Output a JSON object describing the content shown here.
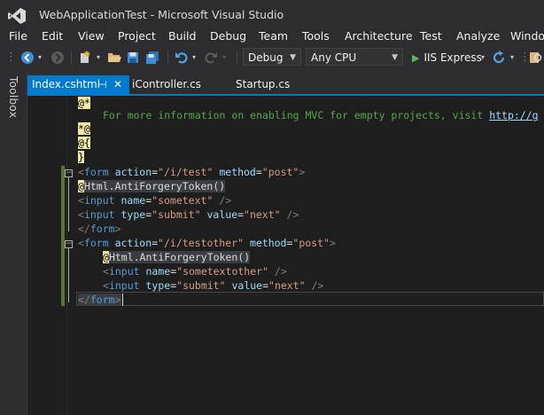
{
  "window": {
    "title": "WebApplicationTest - Microsoft Visual Studio"
  },
  "menu": {
    "items": [
      "File",
      "Edit",
      "View",
      "Project",
      "Build",
      "Debug",
      "Team",
      "Tools",
      "Architecture",
      "Test",
      "Analyze",
      "Window"
    ]
  },
  "toolbar": {
    "config_value": "Debug",
    "platform_value": "Any CPU",
    "run_label": "IIS Express"
  },
  "toolbox": {
    "label": "Toolbox"
  },
  "tabs": [
    {
      "label": "Index.cshtml",
      "active": true
    },
    {
      "label": "iController.cs",
      "active": false
    },
    {
      "label": "Startup.cs",
      "active": false
    }
  ],
  "code": {
    "l1_razor": "@*",
    "l2_comment": "For more information on enabling MVC for empty projects, visit ",
    "l2_link": "http://g",
    "l3_razor": "*@",
    "l4_razor": "@{",
    "l5_razor": "}",
    "form1_open": {
      "lt": "<",
      "name": "form",
      "a1": "action",
      "eq1": "=",
      "v1": "\"/i/test\"",
      "a2": "method",
      "eq2": "=",
      "v2": "\"post\"",
      "gt": ">"
    },
    "form1_token_at": "@",
    "form1_token": "Html.AntiForgeryToken()",
    "form1_input1": {
      "lt": "<",
      "name": "input",
      "a1": "name",
      "eq1": "=",
      "v1": "\"sometext\"",
      "end": " />"
    },
    "form1_input2": {
      "lt": "<",
      "name": "input",
      "a1": "type",
      "eq1": "=",
      "v1": "\"submit\"",
      "a2": "value",
      "eq2": "=",
      "v2": "\"next\"",
      "end": " />"
    },
    "form1_close": {
      "lt": "</",
      "name": "form",
      "gt": ">"
    },
    "form2_open": {
      "lt": "<",
      "name": "form",
      "a1": "action",
      "eq1": "=",
      "v1": "\"/i/testother\"",
      "a2": "method",
      "eq2": "=",
      "v2": "\"post\"",
      "gt": ">"
    },
    "form2_token_at": "@",
    "form2_token": "Html.AntiForgeryToken()",
    "form2_input1": {
      "lt": "<",
      "name": "input",
      "a1": "name",
      "eq1": "=",
      "v1": "\"sometextother\"",
      "end": " />"
    },
    "form2_input2": {
      "lt": "<",
      "name": "input",
      "a1": "type",
      "eq1": "=",
      "v1": "\"submit\"",
      "a2": "value",
      "eq2": "=",
      "v2": "\"next\"",
      "end": " />"
    },
    "form2_close": {
      "lt": "</",
      "name": "form",
      "gt": ">"
    }
  },
  "colors": {
    "accent": "#007acc",
    "editor_bg": "#1e1e1e",
    "chrome_bg": "#2d2d30",
    "razor_highlight": "#f1e9a6",
    "comment": "#57a64a",
    "tag": "#569cd6",
    "attribute": "#9cdcfe",
    "string": "#d69d85",
    "change_marker": "#577430"
  },
  "icons": [
    "vs-logo-icon",
    "back-icon",
    "forward-icon",
    "new-project-icon",
    "open-icon",
    "save-icon",
    "save-all-icon",
    "undo-icon",
    "redo-icon",
    "play-icon",
    "refresh-icon",
    "pin-icon",
    "close-icon",
    "outline-collapse-icon"
  ]
}
